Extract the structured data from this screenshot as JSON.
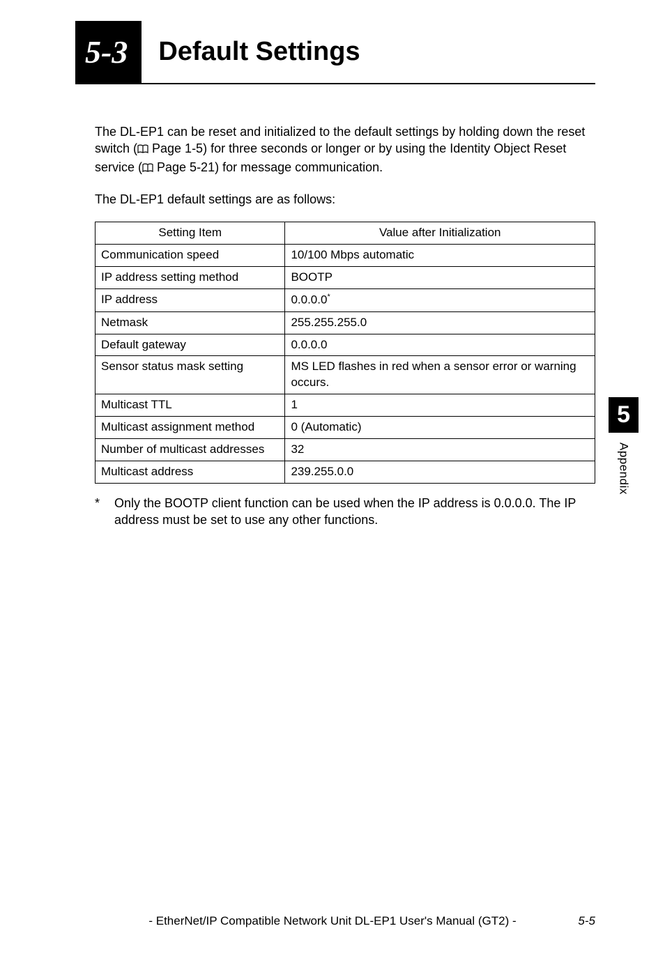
{
  "header": {
    "section_number": "5-3",
    "section_title": "Default Settings"
  },
  "intro": {
    "text_before_ref1": "The DL-EP1 can be reset and initialized to the default settings by holding down the reset switch (",
    "ref1": " Page 1-5",
    "text_between": ") for three seconds or longer or by using the Identity Object Reset service (",
    "ref2": " Page 5-21",
    "text_after": ") for message communication."
  },
  "subintro": "The DL-EP1 default settings are as follows:",
  "table": {
    "headers": {
      "item": "Setting Item",
      "value": "Value after Initialization"
    },
    "rows": [
      {
        "item": "Communication speed",
        "value": "10/100 Mbps automatic"
      },
      {
        "item": "IP address setting method",
        "value": "BOOTP"
      },
      {
        "item": "IP address",
        "value": "0.0.0.0",
        "value_has_star": true
      },
      {
        "item": "Netmask",
        "value": "255.255.255.0"
      },
      {
        "item": "Default gateway",
        "value": "0.0.0.0"
      },
      {
        "item": "Sensor status mask setting",
        "value": "MS LED flashes in red when a sensor error or warning occurs."
      },
      {
        "item": "Multicast TTL",
        "value": "1"
      },
      {
        "item": "Multicast assignment method",
        "value": "0 (Automatic)"
      },
      {
        "item": "Number of multicast addresses",
        "value": "32"
      },
      {
        "item": "Multicast address",
        "value": "239.255.0.0"
      }
    ]
  },
  "footnote": {
    "marker": "*",
    "text": "Only the BOOTP client function can be used when the IP address is 0.0.0.0. The IP address must be set to use any other functions."
  },
  "side": {
    "chapter_number": "5",
    "chapter_label": "Appendix"
  },
  "footer": {
    "text": "- EtherNet/IP Compatible Network Unit DL-EP1 User's Manual (GT2) -",
    "page": "5-5"
  }
}
